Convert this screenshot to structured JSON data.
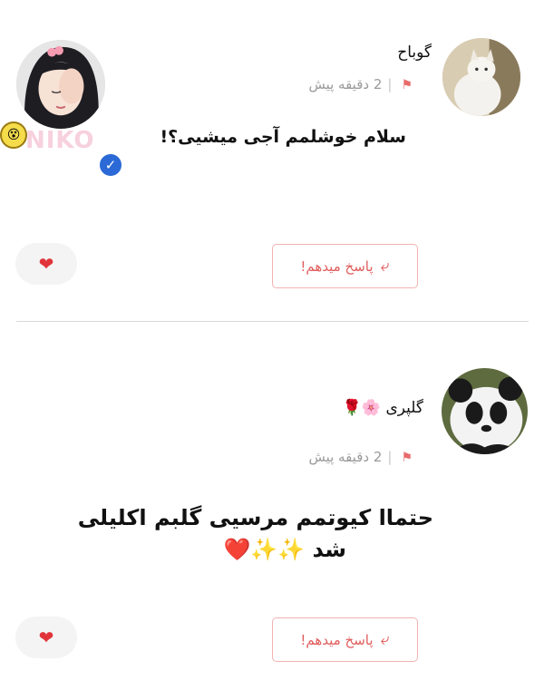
{
  "comments": [
    {
      "username": "گوباح",
      "time": "2 دقیقه پیش",
      "text": "سلام خوشلمم آجی میشیی؟!",
      "reply_label": "پاسخ میدهم!"
    },
    {
      "username": "گلپری 🌸🌹",
      "time": "2 دقیقه پیش",
      "text_line1": "حتماا کیوتمم مرسیی گلبم اکلیلی",
      "text_line2": "شد ✨✨❤️",
      "reply_label": "پاسخ میدهم!"
    }
  ],
  "other_user": {
    "watermark": "NIKO"
  },
  "icons": {
    "flag": "flag-icon",
    "reply": "reply-arrow-icon",
    "heart": "heart-icon",
    "verified": "verified-badge-icon"
  },
  "colors": {
    "accent": "#e05c5c",
    "heart": "#e0343a",
    "verified": "#2a69d6",
    "divider": "#d9d9d9"
  }
}
